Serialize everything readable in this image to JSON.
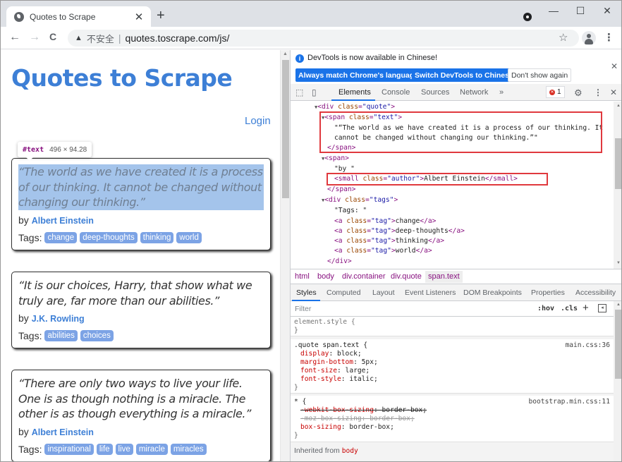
{
  "browser": {
    "tab_title": "Quotes to Scrape",
    "tab_close": "✕",
    "new_tab": "+",
    "window_controls": {
      "minimize": "—",
      "maximize": "☐",
      "close": "✕"
    },
    "nav": {
      "back": "←",
      "forward": "→",
      "reload": "C"
    },
    "omnibox": {
      "security_icon": "▲",
      "security_label": "不安全",
      "separator": "|",
      "url": "quotes.toscrape.com/js/"
    },
    "bookmark_icon": "☆",
    "menu_icon": "⋮"
  },
  "page": {
    "site_title": "Quotes to Scrape",
    "login_label": "Login",
    "tooltip": {
      "node": "#text",
      "size": "496 × 94.28"
    },
    "by_label": "by",
    "tags_label": "Tags:",
    "quotes": [
      {
        "text": "“The world as we have created it is a process of our thinking. It cannot be changed without changing our thinking.”",
        "author": "Albert Einstein",
        "tags": [
          "change",
          "deep-thoughts",
          "thinking",
          "world"
        ],
        "highlighted": true
      },
      {
        "text": "“It is our choices, Harry, that show what we truly are, far more than our abilities.”",
        "author": "J.K. Rowling",
        "tags": [
          "abilities",
          "choices"
        ],
        "highlighted": false
      },
      {
        "text": "“There are only two ways to live your life. One is as though nothing is a miracle. The other is as though everything is a miracle.”",
        "author": "Albert Einstein",
        "tags": [
          "inspirational",
          "life",
          "live",
          "miracle",
          "miracles"
        ],
        "highlighted": false
      }
    ]
  },
  "devtools": {
    "infobar": {
      "message": "DevTools is now available in Chinese!",
      "buttons": [
        "Always match Chrome's language",
        "Switch DevTools to Chinese",
        "Don't show again"
      ],
      "close": "✕"
    },
    "tabs": [
      "Elements",
      "Console",
      "Sources",
      "Network"
    ],
    "more_tabs": "»",
    "active_tab": "Elements",
    "error_count": "1",
    "settings_icon": "⚙",
    "menu_icon": "⋮",
    "close_icon": "✕",
    "dom": {
      "div_quote_class": "quote",
      "span_text_class": "text",
      "text_node_line1": "\"“The world as we have created it is a process of our thinking. It",
      "text_node_line2": "cannot be changed without changing our thinking.”\"",
      "by_text": "\"by \"",
      "author_class": "author",
      "author_text": "Albert Einstein",
      "tags_class": "tags",
      "tags_text": "\"Tags: \"",
      "tag_class": "tag",
      "tag_links": [
        "change",
        "deep-thoughts",
        "thinking",
        "world"
      ]
    },
    "breadcrumbs": [
      "html",
      "body",
      "div.container",
      "div.quote",
      "span.text"
    ],
    "active_breadcrumb": "span.text",
    "sub_tabs": [
      "Styles",
      "Computed",
      "Layout",
      "Event Listeners",
      "DOM Breakpoints",
      "Properties",
      "Accessibility"
    ],
    "active_sub_tab": "Styles",
    "filter_placeholder": "Filter",
    "hov_label": ":hov",
    "cls_label": ".cls",
    "add_rule": "+",
    "styles": {
      "element_style_selector": "element.style {",
      "close_brace": "}",
      "rule1": {
        "selector": ".quote span.text {",
        "source": "main.css:36",
        "props": [
          {
            "name": "display",
            "value": "block;"
          },
          {
            "name": "margin-bottom",
            "value": "5px;"
          },
          {
            "name": "font-size",
            "value": "large;"
          },
          {
            "name": "font-style",
            "value": "italic;"
          }
        ]
      },
      "rule2": {
        "selector": "* {",
        "source": "bootstrap.min.css:11",
        "props": [
          {
            "name": "-webkit-box-sizing",
            "value": "border-box;",
            "struck": true
          },
          {
            "name": "-moz-box-sizing",
            "value": "border-box;",
            "struck": true
          },
          {
            "name": "box-sizing",
            "value": "border-box;"
          }
        ]
      },
      "inherited_label": "Inherited from",
      "inherited_from": "body"
    }
  }
}
